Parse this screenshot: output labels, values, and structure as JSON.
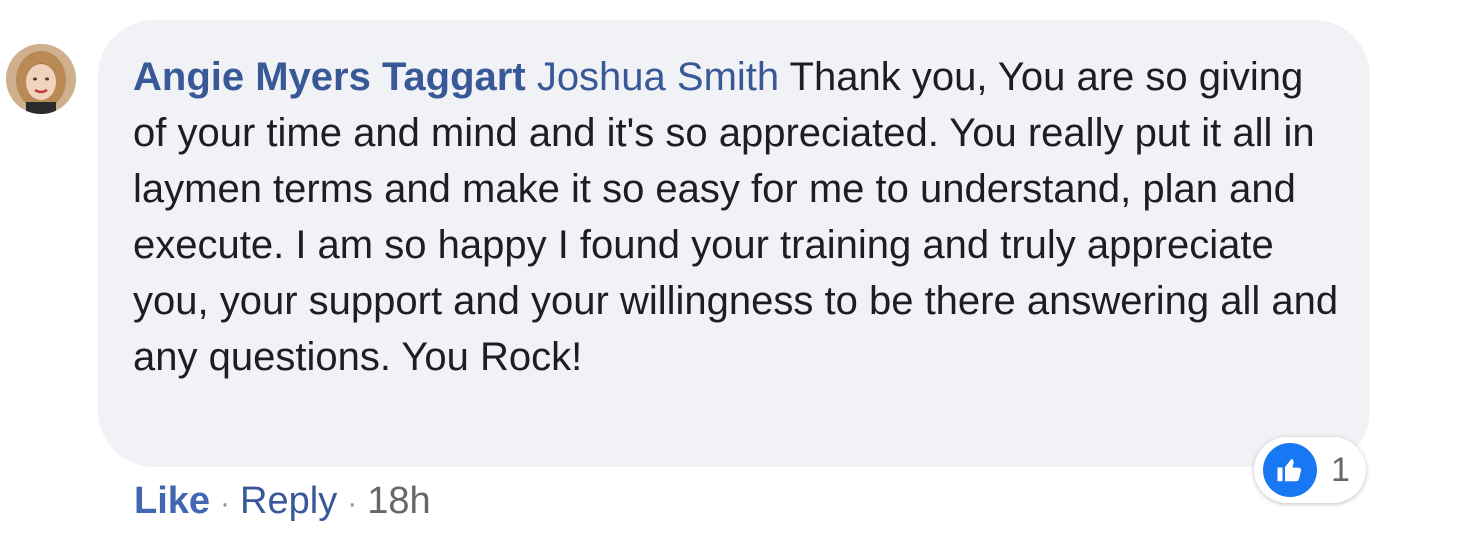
{
  "comment": {
    "author": "Angie Myers Taggart",
    "mention": "Joshua Smith",
    "text": "Thank you, You are so giving of your time and mind and it's so appreciated. You really put it all in laymen terms and make it so easy for me to understand, plan and execute. I am so happy I found your training and truly appreciate you, your support and your willingness to be there answering all and any questions. You Rock!"
  },
  "reaction": {
    "icon": "thumbs-up-icon",
    "count": "1",
    "color": "#1877f2"
  },
  "actions": {
    "like_label": "Like",
    "separator": "·",
    "reply_label": "Reply",
    "timestamp": "18h"
  },
  "colors": {
    "bubble": "#f0f2f5",
    "author": "#385898",
    "like": "#4267b2"
  }
}
